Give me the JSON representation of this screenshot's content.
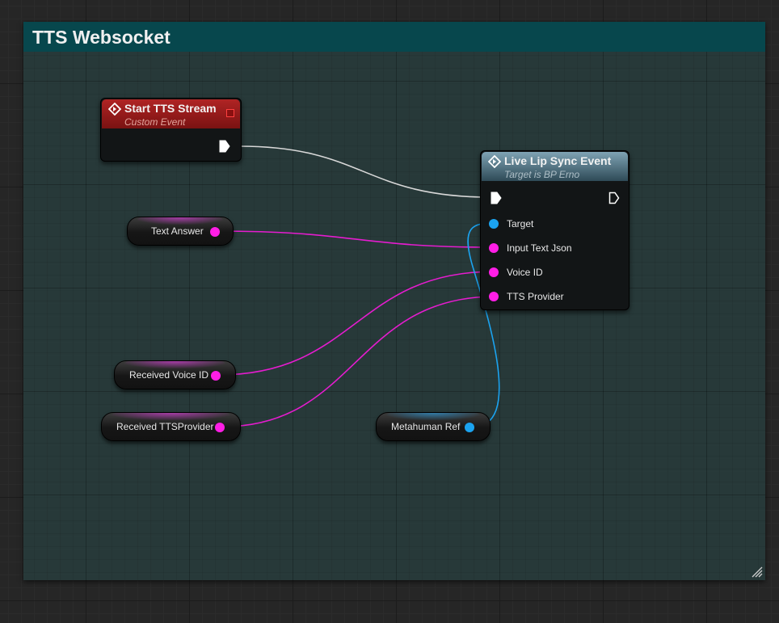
{
  "comment": {
    "title": "TTS Websocket",
    "color": "#07474d"
  },
  "start_event": {
    "title": "Start TTS Stream",
    "subtitle": "Custom Event"
  },
  "lip_sync_node": {
    "title": "Live Lip Sync Event",
    "subtitle": "Target is BP Erno",
    "pins": [
      {
        "label": "Target",
        "type": "object"
      },
      {
        "label": "Input Text Json",
        "type": "string"
      },
      {
        "label": "Voice ID",
        "type": "string"
      },
      {
        "label": "TTS Provider",
        "type": "string"
      }
    ]
  },
  "variables": [
    {
      "label": "Text Answer",
      "type": "string"
    },
    {
      "label": "Received Voice ID",
      "type": "string"
    },
    {
      "label": "Received TTSProvider",
      "type": "string"
    },
    {
      "label": "Metahuman Ref",
      "type": "object"
    }
  ],
  "colors": {
    "string_pin": "#ff1ee6",
    "object_pin": "#1ba3f0",
    "exec_wire": "#d8d8d8",
    "event_header": "#a31b1b",
    "function_header": "#5f8596"
  }
}
